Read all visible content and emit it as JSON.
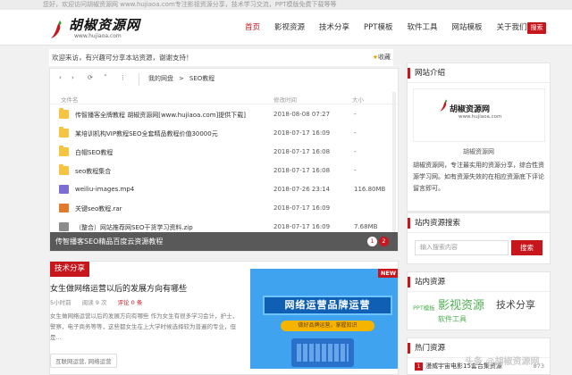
{
  "topbar": {
    "text": "您好，欢迎访问胡椒资源网 www.hujiaoa.com专注影视资源分享，技术学习交流，PPT模版免费下载等等"
  },
  "header": {
    "logo_text": "胡椒资源网",
    "logo_url": "www.hujiaoa.com",
    "nav": [
      {
        "label": "首页",
        "active": true
      },
      {
        "label": "影视资源"
      },
      {
        "label": "技术分享"
      },
      {
        "label": "PPT模板"
      },
      {
        "label": "软件工具"
      },
      {
        "label": "网站模板"
      },
      {
        "label": "关于我们"
      }
    ],
    "search_label": "搜索"
  },
  "notice": {
    "text": "欢迎来访，有兴趣可分享本站资源，谢谢支持！",
    "fav_label": "收藏"
  },
  "file_manager": {
    "breadcrumb": [
      "我的网盘",
      "SEO教程"
    ],
    "columns": {
      "name": "文件名",
      "date": "修改时间",
      "size": "大小"
    },
    "files": [
      {
        "type": "folder",
        "name": "传智播客全牌教程 胡椒资源网[www.hujiaoa.com]提供下载]",
        "date": "2018-08-08 07:27",
        "size": "-"
      },
      {
        "type": "folder",
        "name": "某培训机构VIP教程SEO全套精品教程价值30000元",
        "date": "2018-07-17 16:09",
        "size": "-"
      },
      {
        "type": "folder",
        "name": "白帽SEO教程",
        "date": "2018-07-17 16:08",
        "size": "-"
      },
      {
        "type": "folder",
        "name": "seo教程集合",
        "date": "2018-07-17 16:08",
        "size": "-"
      },
      {
        "type": "video",
        "name": "weiliu-images.mp4",
        "date": "2018-07-26 23:14",
        "size": "116.80MB"
      },
      {
        "type": "rar",
        "name": "关键seo教程.rar",
        "date": "2018-07-17 16:09",
        "size": ""
      },
      {
        "type": "zip",
        "name": "（整合）网站推荐网SEO干货学习资料.zip",
        "date": "2018-07-17 16:09",
        "size": "7.68MB"
      }
    ],
    "caption": "传智播客SEO精品百度云资源教程",
    "pager": [
      "1",
      "2"
    ]
  },
  "post": {
    "tag": "技术分享",
    "title": "女生做网络运营以后的发展方向有哪些",
    "time": "5小时前",
    "views": "阅读 9 次",
    "comments": "评论 0 条",
    "excerpt": "女生做网络运营以后的发展方向有哪些 作为女生有很多学习会计，护士，警察，电子商务等等，这些都女生在上大学时候选择较为普遍的专业，但是...",
    "cats": "互联网运营, 网络运营",
    "banner_title": "网络运营品牌运营",
    "banner_sub": "做好品牌运营，掌握知识",
    "new_label": "NEW"
  },
  "sidebar": {
    "about": {
      "title": "网站介绍",
      "logo_text": "胡椒资源网",
      "logo_url": "www.hujiaoa.com",
      "name": "胡椒资源网",
      "desc": "胡椒资源网，专注最实用的资源分享，综合性资源学习网。如有资源失效的在相应资源底下评论留言即可。"
    },
    "search": {
      "title": "站内资源搜索",
      "placeholder": "输入搜索内容",
      "button": "搜索"
    },
    "tags": {
      "title": "站内资源",
      "items": [
        {
          "label": "PPT模板"
        },
        {
          "label": "影视资源"
        },
        {
          "label": "技术分享"
        },
        {
          "label": "软件工具"
        }
      ]
    },
    "hot": {
      "title": "热门资源",
      "item": {
        "num": "1",
        "text": "漫威宇宙电影15套合集资源",
        "count": "873"
      }
    }
  },
  "colors": {
    "brand_red": "#c8161d",
    "tag_green": "#4caf50",
    "tag_gray": "#666666"
  },
  "watermark": "头条 @胡椒资源网"
}
